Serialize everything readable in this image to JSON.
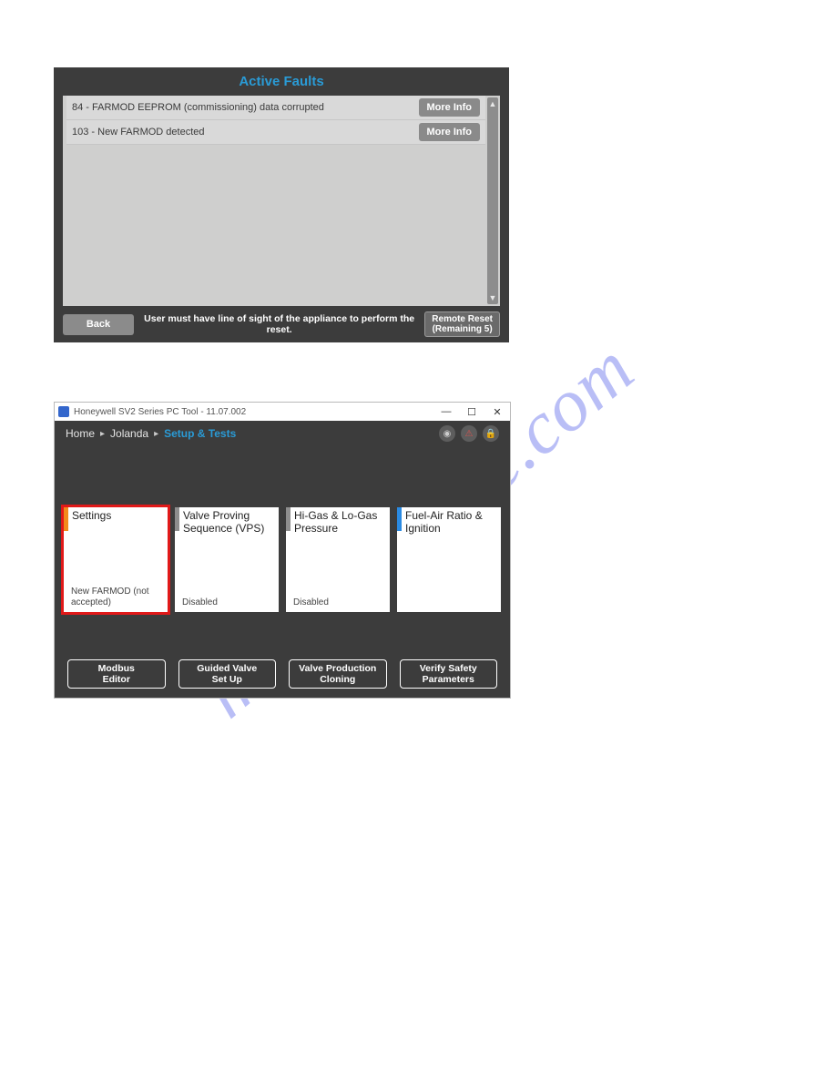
{
  "watermark": "manualshive.com",
  "panel1": {
    "title": "Active Faults",
    "faults": [
      {
        "text": "84 - FARMOD EEPROM (commissioning) data corrupted",
        "button": "More Info"
      },
      {
        "text": "103 - New FARMOD detected",
        "button": "More Info"
      }
    ],
    "back_label": "Back",
    "reset_notice": "User must have line of sight of the appliance to perform the reset.",
    "remote_reset_line1": "Remote Reset",
    "remote_reset_line2": "(Remaining 5)"
  },
  "panel2": {
    "window_title": "Honeywell SV2 Series PC Tool - 11.07.002",
    "breadcrumb": {
      "home": "Home",
      "device": "Jolanda",
      "current": "Setup & Tests"
    },
    "header_icons": [
      "camera-icon",
      "alert-icon",
      "lock-icon"
    ],
    "cards": [
      {
        "accent": "#f28a1c",
        "title": "Settings",
        "status": "New FARMOD (not accepted)",
        "highlight": true
      },
      {
        "accent": "#8e8e8e",
        "title": "Valve Proving Sequence (VPS)",
        "status": "Disabled",
        "highlight": false
      },
      {
        "accent": "#8e8e8e",
        "title": "Hi-Gas & Lo-Gas Pressure",
        "status": "Disabled",
        "highlight": false
      },
      {
        "accent": "#2a8ae2",
        "title": "Fuel-Air Ratio & Ignition",
        "status": "",
        "highlight": false
      }
    ],
    "bottom_buttons": [
      {
        "line1": "Modbus",
        "line2": "Editor"
      },
      {
        "line1": "Guided Valve",
        "line2": "Set Up"
      },
      {
        "line1": "Valve Production",
        "line2": "Cloning"
      },
      {
        "line1": "Verify Safety",
        "line2": "Parameters"
      }
    ]
  }
}
